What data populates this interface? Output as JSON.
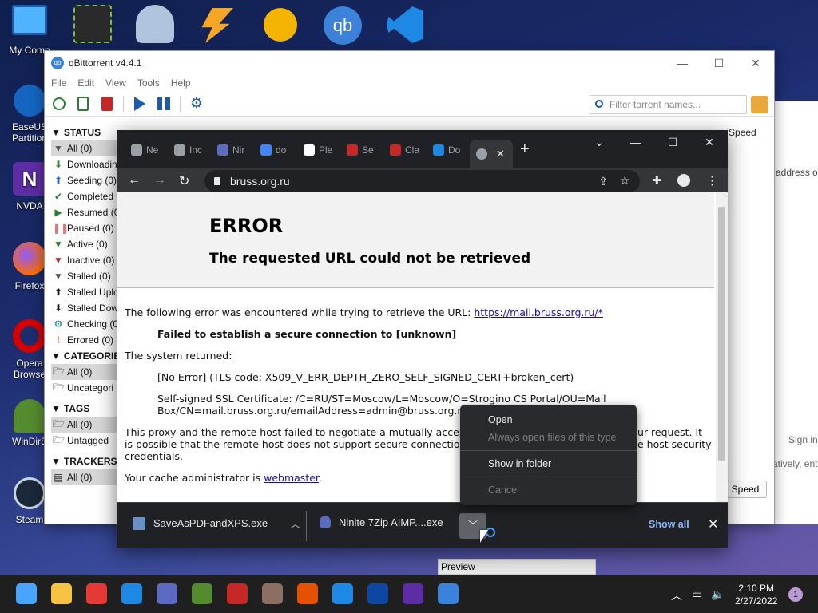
{
  "desktop": {
    "icons": [
      {
        "label": "My Comp",
        "color": "#1e88e5"
      },
      {
        "label": "EaseUS Partition",
        "color": "#1565c0"
      },
      {
        "label": "NVDA",
        "color": "#5e2ca5"
      },
      {
        "label": "Firefox",
        "color": "#ff6d00"
      },
      {
        "label": "Opera Browse",
        "color": "#d50000"
      },
      {
        "label": "WinDirS",
        "color": "#2e7d32"
      },
      {
        "label": "Steam",
        "color": "#1b2838"
      }
    ]
  },
  "qbt": {
    "title": "qBittorrent v4.4.1",
    "logo": "qb",
    "window_controls": [
      "—",
      "☐",
      "✕"
    ],
    "menu": [
      "File",
      "Edit",
      "View",
      "Tools",
      "Help"
    ],
    "search_placeholder": "Filter torrent names...",
    "sections": {
      "status": "STATUS",
      "categories": "CATEGORIES",
      "tags": "TAGS",
      "trackers": "TRACKERS"
    },
    "status_items": [
      {
        "label": "All (0)",
        "icon": "filter-icon",
        "glyph": "▼",
        "color": "#555"
      },
      {
        "label": "Downloadin",
        "icon": "download-arrow-icon",
        "glyph": "⬇",
        "color": "#2e7d32"
      },
      {
        "label": "Seeding (0)",
        "icon": "upload-arrow-icon",
        "glyph": "⬆",
        "color": "#1565c0"
      },
      {
        "label": "Completed",
        "icon": "check-icon",
        "glyph": "✔",
        "color": "#2e7d32"
      },
      {
        "label": "Resumed (0",
        "icon": "play-icon",
        "glyph": "▶",
        "color": "#2e7d32"
      },
      {
        "label": "Paused (0)",
        "icon": "pause-icon",
        "glyph": "❚❚",
        "color": "#e57373"
      },
      {
        "label": "Active (0)",
        "icon": "filter-green-icon",
        "glyph": "▼",
        "color": "#2e7d32"
      },
      {
        "label": "Inactive (0)",
        "icon": "filter-red-icon",
        "glyph": "▼",
        "color": "#a33"
      },
      {
        "label": "Stalled (0)",
        "icon": "filter-gray-icon",
        "glyph": "▼",
        "color": "#555"
      },
      {
        "label": "Stalled Uplo",
        "icon": "arrow-up-icon",
        "glyph": "⬆",
        "color": "#111"
      },
      {
        "label": "Stalled Dow",
        "icon": "arrow-down-icon",
        "glyph": "⬇",
        "color": "#111"
      },
      {
        "label": "Checking (0",
        "icon": "gear-icon",
        "glyph": "⚙",
        "color": "#00897b"
      },
      {
        "label": "Errored (0)",
        "icon": "exclamation-icon",
        "glyph": "!",
        "color": "#d32f2f"
      }
    ],
    "category_items": [
      "All (0)",
      "Uncategori"
    ],
    "tag_items": [
      "All (0)",
      "Untagged"
    ],
    "tracker_items": [
      "All (0)"
    ],
    "column_speed": "Speed",
    "right_speed_button": "Speed",
    "preview_tab": "Preview"
  },
  "side_window": {
    "address_text": "address or",
    "sign_in": "Sign in",
    "alt_text": "atively, ent"
  },
  "chrome": {
    "tabs": [
      {
        "label": "Ne",
        "color": "#9aa0a6"
      },
      {
        "label": "Inc",
        "color": "#9aa0a6"
      },
      {
        "label": "Nir",
        "color": "#5c6bc0"
      },
      {
        "label": "do",
        "color": "#4285f4"
      },
      {
        "label": "Ple",
        "color": "#ffffff"
      },
      {
        "label": "Se",
        "color": "#c62828"
      },
      {
        "label": "Cla",
        "color": "#c62828"
      },
      {
        "label": "Do",
        "color": "#1e88e5"
      }
    ],
    "window_controls": [
      "⌄",
      "—",
      "☐",
      "✕"
    ],
    "new_tab": "+",
    "close_tab": "✕",
    "url": "bruss.org.ru",
    "page": {
      "h1": "ERROR",
      "h2": "The requested URL could not be retrieved",
      "p1_prefix": "The following error was encountered while trying to retrieve the URL: ",
      "p1_link": "https://mail.bruss.org.ru/*",
      "p2": "Failed to establish a secure connection to [unknown]",
      "p3": "The system returned:",
      "p4": "[No Error] (TLS code: X509_V_ERR_DEPTH_ZERO_SELF_SIGNED_CERT+broken_cert)",
      "p5_line1": "Self-signed SSL Certificate: /C=RU/ST=Moscow/L=Moscow/O=Strogino CS Portal/OU=Mail",
      "p5_line2": "Box/CN=mail.bruss.org.ru/emailAddress=admin@bruss.org.ru",
      "p6_line1_left": "This proxy and the remote host failed to negotiate a mutually accepta",
      "p6_line1_right": "ur request. It",
      "p6_line2_left": "is possible that the remote host does not support secure connections",
      "p6_line2_right": "e host security",
      "p6_line3": "credentials.",
      "p7_prefix": "Your cache administrator is ",
      "p7_link": "webmaster",
      "p7_suffix": "."
    },
    "downloads": [
      {
        "name": "SaveAsPDFandXPS.exe"
      },
      {
        "name": "Ninite 7Zip AIMP....exe"
      }
    ],
    "show_all": "Show all"
  },
  "context_menu": {
    "items": [
      {
        "label": "Open",
        "disabled": false
      },
      {
        "label": "Always open files of this type",
        "disabled": true
      },
      {
        "label": "Show in folder",
        "disabled": false
      },
      {
        "label": "Cancel",
        "disabled": true
      }
    ]
  },
  "taskbar": {
    "time": "2:10 PM",
    "date": "2/27/2022",
    "notification_count": "1",
    "apps": [
      {
        "name": "start-icon",
        "color": "#4aa3ff"
      },
      {
        "name": "file-explorer-icon",
        "color": "#f5c242"
      },
      {
        "name": "chrome-icon",
        "color": "#e53935"
      },
      {
        "name": "app-blue-icon",
        "color": "#1e88e5"
      },
      {
        "name": "app-purple-icon",
        "color": "#5c6bc0"
      },
      {
        "name": "windirstat-icon",
        "color": "#558b2f"
      },
      {
        "name": "app-red-icon",
        "color": "#c62828"
      },
      {
        "name": "app-orb-icon",
        "color": "#8d6e63"
      },
      {
        "name": "app-eye-icon",
        "color": "#e65100"
      },
      {
        "name": "vs-code-icon",
        "color": "#1e88e5"
      },
      {
        "name": "app-moon-icon",
        "color": "#0d47a1"
      },
      {
        "name": "nvda-icon",
        "color": "#5e2ca5"
      },
      {
        "name": "qbittorrent-icon",
        "color": "#3b82d8"
      }
    ]
  }
}
